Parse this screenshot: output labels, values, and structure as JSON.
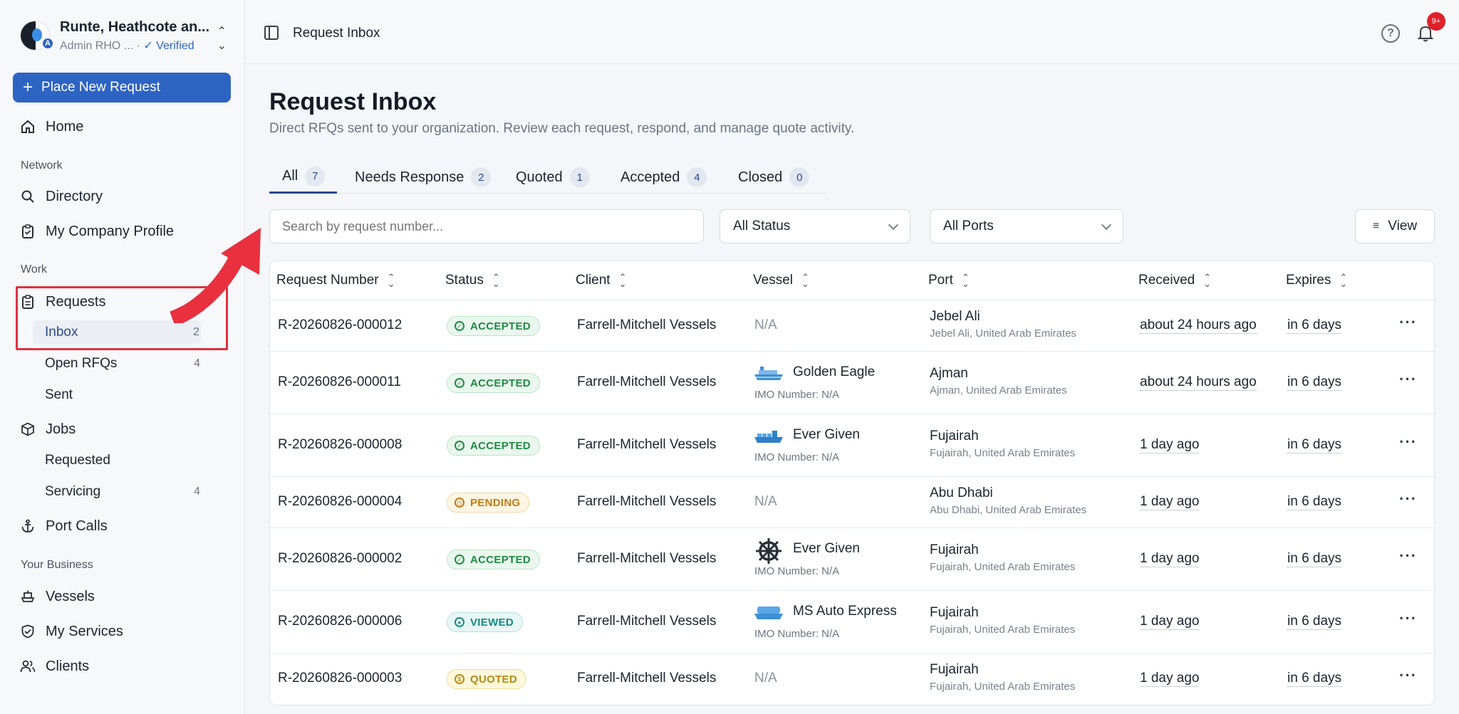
{
  "org": {
    "name": "Runte, Heathcote an...",
    "role": "Admin RHO ...",
    "separator": "·",
    "verified": "Verified",
    "badge": "A"
  },
  "sidebar": {
    "place_request": "Place New Request",
    "home": "Home",
    "sections": {
      "network": "Network",
      "work": "Work",
      "business": "Your Business"
    },
    "directory": "Directory",
    "company_profile": "My Company Profile",
    "requests": "Requests",
    "inbox": {
      "label": "Inbox",
      "count": "2"
    },
    "open_rfqs": {
      "label": "Open RFQs",
      "count": "4"
    },
    "sent": {
      "label": "Sent"
    },
    "jobs": "Jobs",
    "requested": {
      "label": "Requested"
    },
    "servicing": {
      "label": "Servicing",
      "count": "4"
    },
    "port_calls": "Port Calls",
    "vessels": "Vessels",
    "my_services": "My Services",
    "clients": "Clients"
  },
  "topbar": {
    "breadcrumb": "Request Inbox",
    "notifications": "9+"
  },
  "page": {
    "title": "Request Inbox",
    "description": "Direct RFQs sent to your organization. Review each request, respond, and manage quote activity."
  },
  "tabs": [
    {
      "label": "All",
      "count": "7"
    },
    {
      "label": "Needs Response",
      "count": "2"
    },
    {
      "label": "Quoted",
      "count": "1"
    },
    {
      "label": "Accepted",
      "count": "4"
    },
    {
      "label": "Closed",
      "count": "0"
    }
  ],
  "filters": {
    "search_placeholder": "Search by request number...",
    "status": "All Status",
    "ports": "All Ports",
    "view": "View"
  },
  "columns": [
    "Request Number",
    "Status",
    "Client",
    "Vessel",
    "Port",
    "Received",
    "Expires"
  ],
  "rows": [
    {
      "number": "R-20260826-000012",
      "status": "ACCEPTED",
      "client": "Farrell-Mitchell Vessels",
      "vessel": "N/A",
      "imo": "",
      "port": "Jebel Ali",
      "port_sub": "Jebel Ali, United Arab Emirates",
      "received": "about 24 hours ago",
      "expires": "in 6 days"
    },
    {
      "number": "R-20260826-000011",
      "status": "ACCEPTED",
      "client": "Farrell-Mitchell Vessels",
      "vessel": "Golden Eagle",
      "imo": "IMO Number: N/A",
      "port": "Ajman",
      "port_sub": "Ajman, United Arab Emirates",
      "received": "about 24 hours ago",
      "expires": "in 6 days"
    },
    {
      "number": "R-20260826-000008",
      "status": "ACCEPTED",
      "client": "Farrell-Mitchell Vessels",
      "vessel": "Ever Given",
      "imo": "IMO Number: N/A",
      "port": "Fujairah",
      "port_sub": "Fujairah, United Arab Emirates",
      "received": "1 day ago",
      "expires": "in 6 days"
    },
    {
      "number": "R-20260826-000004",
      "status": "PENDING",
      "client": "Farrell-Mitchell Vessels",
      "vessel": "N/A",
      "imo": "",
      "port": "Abu Dhabi",
      "port_sub": "Abu Dhabi, United Arab Emirates",
      "received": "1 day ago",
      "expires": "in 6 days"
    },
    {
      "number": "R-20260826-000002",
      "status": "ACCEPTED",
      "client": "Farrell-Mitchell Vessels",
      "vessel": "Ever Given",
      "imo": "IMO Number: N/A",
      "port": "Fujairah",
      "port_sub": "Fujairah, United Arab Emirates",
      "received": "1 day ago",
      "expires": "in 6 days"
    },
    {
      "number": "R-20260826-000006",
      "status": "VIEWED",
      "client": "Farrell-Mitchell Vessels",
      "vessel": "MS Auto Express",
      "imo": "IMO Number: N/A",
      "port": "Fujairah",
      "port_sub": "Fujairah, United Arab Emirates",
      "received": "1 day ago",
      "expires": "in 6 days"
    },
    {
      "number": "R-20260826-000003",
      "status": "QUOTED",
      "client": "Farrell-Mitchell Vessels",
      "vessel": "N/A",
      "imo": "",
      "port": "Fujairah",
      "port_sub": "Fujairah, United Arab Emirates",
      "received": "1 day ago",
      "expires": "in 6 days"
    }
  ],
  "colors": {
    "accent": "#2d64c4",
    "highlight": "#e03040",
    "accepted": "#1f8a43",
    "pending": "#c27a12",
    "viewed": "#178a82",
    "quoted": "#b58a10"
  }
}
